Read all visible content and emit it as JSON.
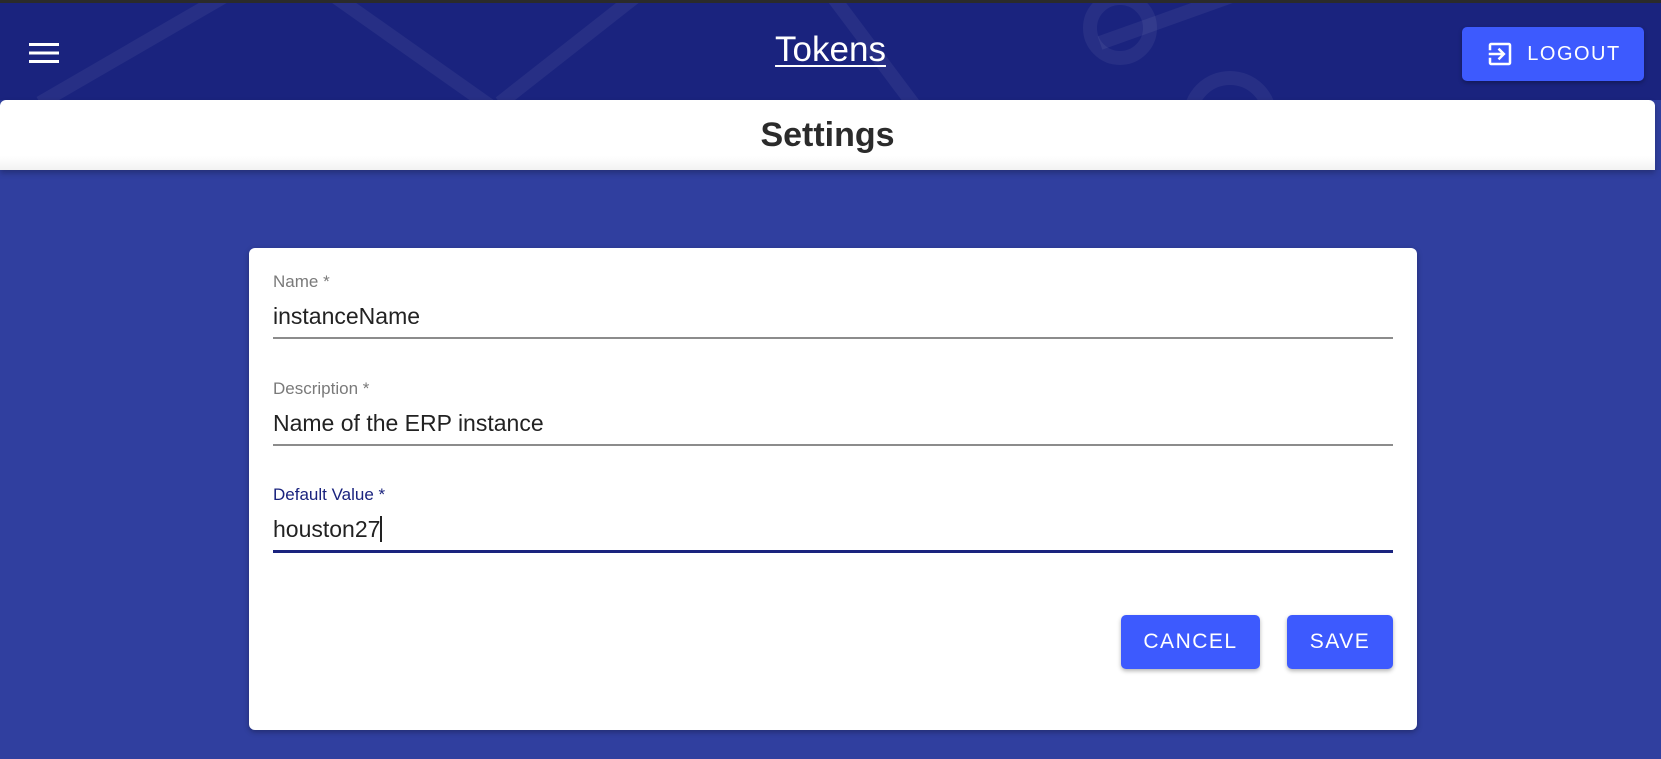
{
  "header": {
    "title": "Tokens",
    "logout_label": "LOGOUT"
  },
  "page": {
    "heading": "Settings"
  },
  "form": {
    "fields": [
      {
        "label": "Name *",
        "value": "instanceName"
      },
      {
        "label": "Description *",
        "value": "Name of the ERP instance"
      },
      {
        "label": "Default Value *",
        "value": "houston27"
      }
    ],
    "cancel_label": "CANCEL",
    "save_label": "SAVE"
  },
  "icons": {
    "menu": "hamburger-menu-icon",
    "logout": "logout-icon"
  },
  "colors": {
    "appbar": "#1a237e",
    "background": "#303f9f",
    "accent": "#3d5afe",
    "focus": "#1a237e"
  }
}
